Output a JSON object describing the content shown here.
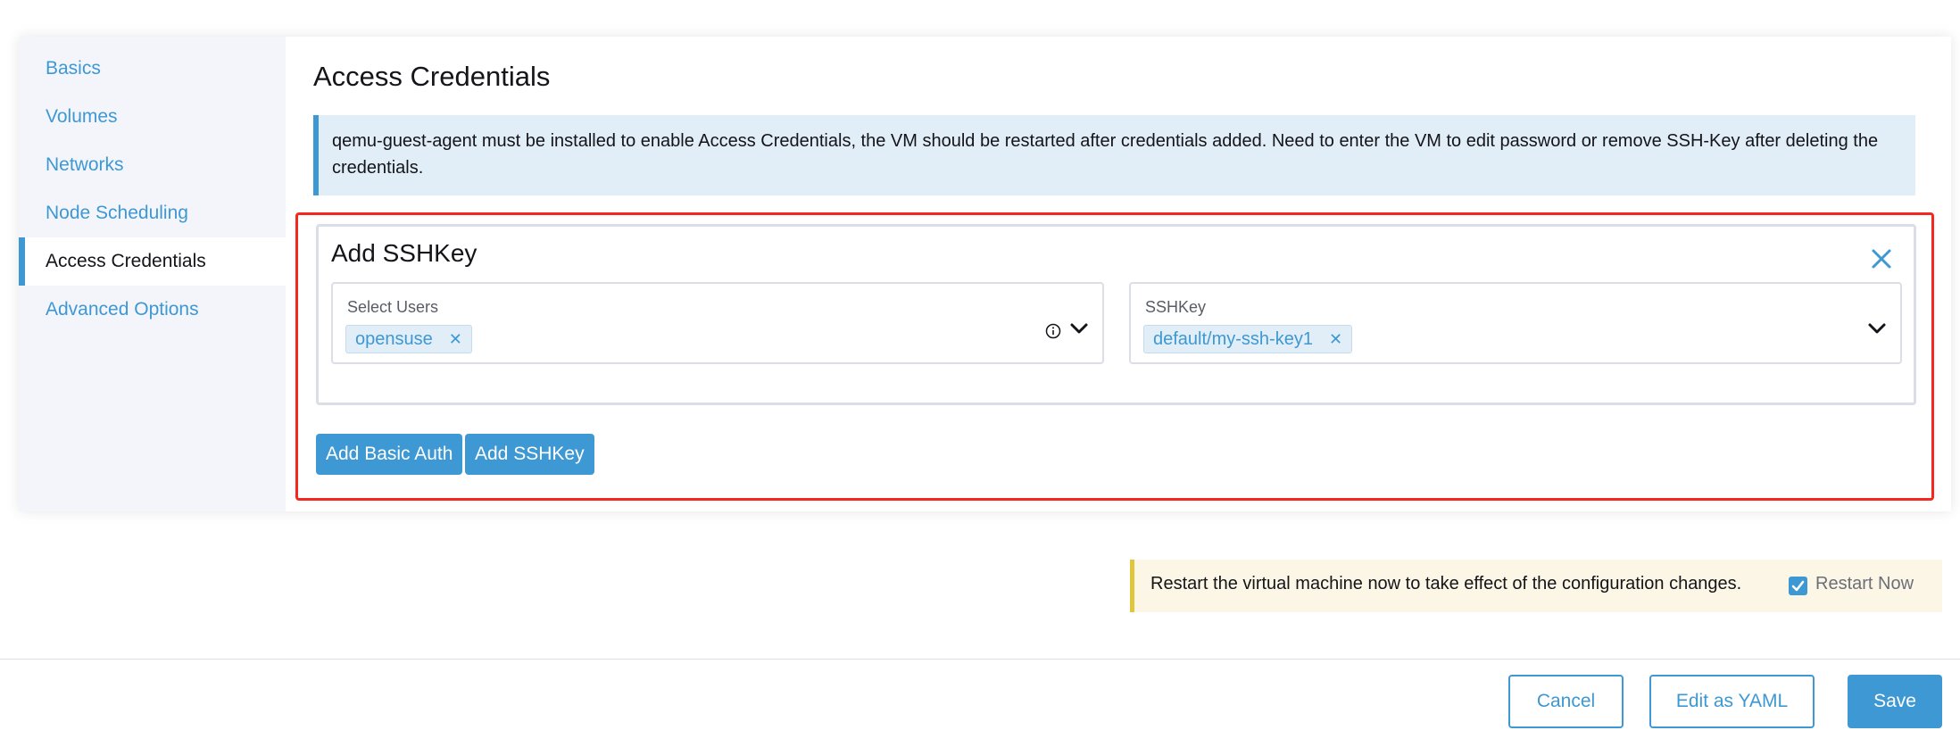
{
  "sidebar": {
    "items": [
      {
        "label": "Basics"
      },
      {
        "label": "Volumes"
      },
      {
        "label": "Networks"
      },
      {
        "label": "Node Scheduling"
      },
      {
        "label": "Access Credentials",
        "active": true
      },
      {
        "label": "Advanced Options"
      }
    ]
  },
  "main": {
    "title": "Access Credentials",
    "info_banner": "qemu-guest-agent must be installed to enable Access Credentials, the VM should be restarted after credentials added. Need to enter the VM to edit password or remove SSH-Key after deleting the credentials.",
    "ssh_panel": {
      "title": "Add SSHKey",
      "close_icon": "close-icon",
      "users_field": {
        "label": "Select Users",
        "selected": [
          "opensuse"
        ]
      },
      "keys_field": {
        "label": "SSHKey",
        "selected": [
          "default/my-ssh-key1"
        ]
      }
    },
    "buttons": {
      "add_basic_auth": "Add Basic Auth",
      "add_sshkey": "Add SSHKey"
    }
  },
  "restart_banner": {
    "message": "Restart the virtual machine now to take effect of the configuration changes.",
    "checkbox_label": "Restart Now",
    "checked": true
  },
  "footer": {
    "cancel": "Cancel",
    "edit_yaml": "Edit as YAML",
    "save": "Save"
  },
  "colors": {
    "accent": "#3d98d3",
    "highlight_border": "#f4281f",
    "info_bg": "#e1eef8",
    "warning_bg": "#fbf6e5",
    "warning_border": "#e0c63d"
  }
}
